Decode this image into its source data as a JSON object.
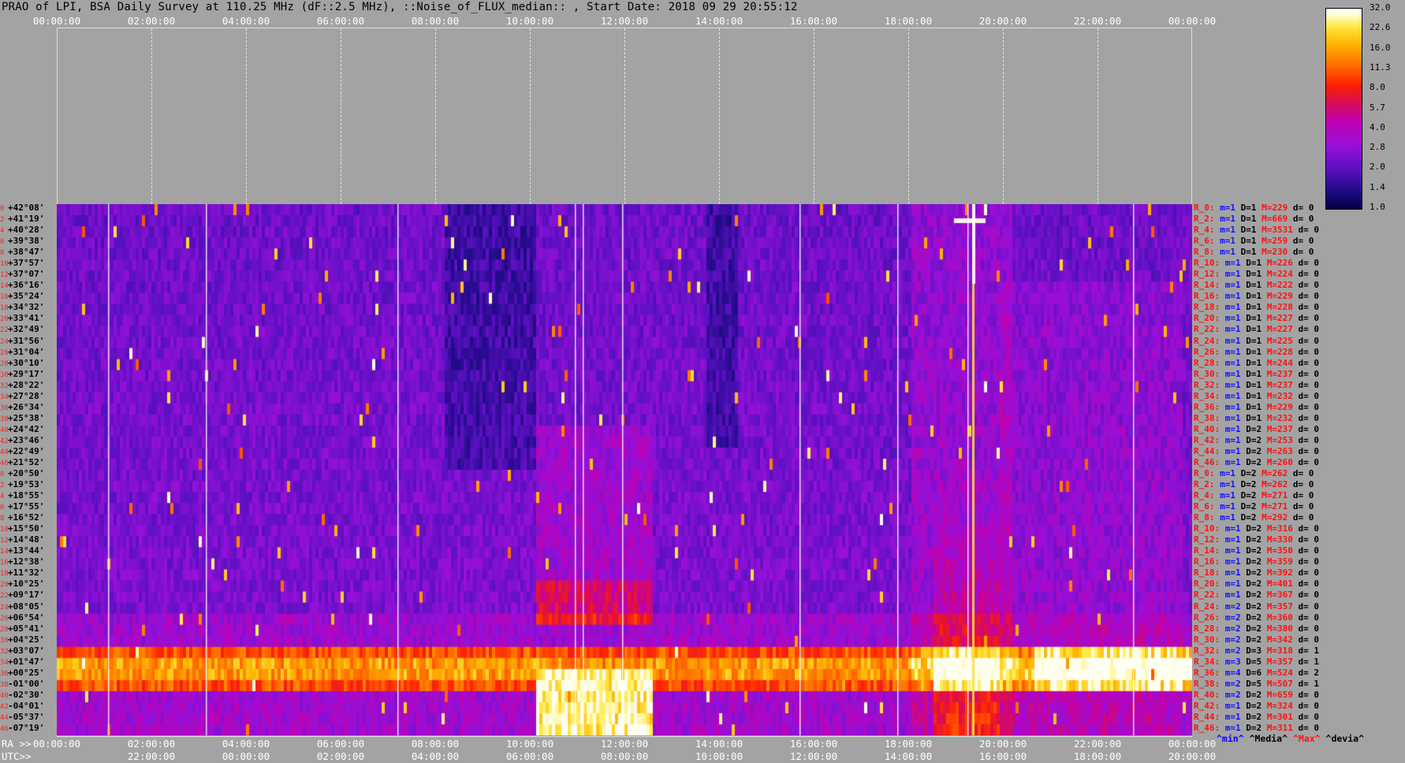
{
  "title": "PRAO of LPI, BSA Daily Survey at 110.25 MHz (dF::2.5 MHz), ::Noise_of_FLUX_median:: , Start Date: 2018 09 29 20:55:12",
  "top_axis_labels": [
    "00:00:00",
    "02:00:00",
    "04:00:00",
    "06:00:00",
    "08:00:00",
    "10:00:00",
    "12:00:00",
    "14:00:00",
    "16:00:00",
    "18:00:00",
    "20:00:00",
    "22:00:00",
    "00:00:00"
  ],
  "ra_axis_labels": [
    "00:00:00",
    "02:00:00",
    "04:00:00",
    "06:00:00",
    "08:00:00",
    "10:00:00",
    "12:00:00",
    "14:00:00",
    "16:00:00",
    "18:00:00",
    "20:00:00",
    "22:00:00",
    "00:00:00"
  ],
  "utc_axis_labels": [
    "22:00:00",
    "00:00:00",
    "02:00:00",
    "04:00:00",
    "06:00:00",
    "08:00:00",
    "10:00:00",
    "12:00:00",
    "14:00:00",
    "16:00:00",
    "18:00:00",
    "20:00:00"
  ],
  "ra_prefix": "RA >>",
  "utc_prefix": "UTC>>",
  "colorbar": {
    "ticks": [
      "32.0",
      "22.6",
      "16.0",
      "11.3",
      "8.0",
      "5.7",
      "4.0",
      "2.8",
      "2.0",
      "1.4",
      "1.0"
    ],
    "colors": [
      "#000040",
      "#5a10c0",
      "#c000b0",
      "#ff2000",
      "#ffb000",
      "#ffffff"
    ]
  },
  "declinations": [
    {
      "idx": "0",
      "dec": "+42°08'"
    },
    {
      "idx": "2",
      "dec": "+41°19'"
    },
    {
      "idx": "4",
      "dec": "+40°28'"
    },
    {
      "idx": "6",
      "dec": "+39°38'"
    },
    {
      "idx": "8",
      "dec": "+38°47'"
    },
    {
      "idx": "10",
      "dec": "+37°57'"
    },
    {
      "idx": "12",
      "dec": "+37°07'"
    },
    {
      "idx": "14",
      "dec": "+36°16'"
    },
    {
      "idx": "16",
      "dec": "+35°24'"
    },
    {
      "idx": "18",
      "dec": "+34°32'"
    },
    {
      "idx": "20",
      "dec": "+33°41'"
    },
    {
      "idx": "22",
      "dec": "+32°49'"
    },
    {
      "idx": "24",
      "dec": "+31°56'"
    },
    {
      "idx": "26",
      "dec": "+31°04'"
    },
    {
      "idx": "28",
      "dec": "+30°10'"
    },
    {
      "idx": "30",
      "dec": "+29°17'"
    },
    {
      "idx": "32",
      "dec": "+28°22'"
    },
    {
      "idx": "34",
      "dec": "+27°28'"
    },
    {
      "idx": "36",
      "dec": "+26°34'"
    },
    {
      "idx": "38",
      "dec": "+25°38'"
    },
    {
      "idx": "40",
      "dec": "+24°42'"
    },
    {
      "idx": "42",
      "dec": "+23°46'"
    },
    {
      "idx": "44",
      "dec": "+22°49'"
    },
    {
      "idx": "46",
      "dec": "+21°52'"
    },
    {
      "idx": "0",
      "dec": "+20°50'"
    },
    {
      "idx": "2",
      "dec": "+19°53'"
    },
    {
      "idx": "4",
      "dec": "+18°55'"
    },
    {
      "idx": "6",
      "dec": "+17°55'"
    },
    {
      "idx": "8",
      "dec": "+16°52'"
    },
    {
      "idx": "10",
      "dec": "+15°50'"
    },
    {
      "idx": "12",
      "dec": "+14°48'"
    },
    {
      "idx": "14",
      "dec": "+13°44'"
    },
    {
      "idx": "16",
      "dec": "+12°38'"
    },
    {
      "idx": "18",
      "dec": "+11°32'"
    },
    {
      "idx": "20",
      "dec": "+10°25'"
    },
    {
      "idx": "22",
      "dec": "+09°17'"
    },
    {
      "idx": "24",
      "dec": "+08°05'"
    },
    {
      "idx": "26",
      "dec": "+06°54'"
    },
    {
      "idx": "28",
      "dec": "+05°41'"
    },
    {
      "idx": "30",
      "dec": "+04°25'"
    },
    {
      "idx": "32",
      "dec": "+03°07'"
    },
    {
      "idx": "34",
      "dec": "+01°47'"
    },
    {
      "idx": "36",
      "dec": "+00°25'"
    },
    {
      "idx": "38",
      "dec": "-01°00'"
    },
    {
      "idx": "40",
      "dec": "-02°30'"
    },
    {
      "idx": "42",
      "dec": "-04°01'"
    },
    {
      "idx": "44",
      "dec": "-05°37'"
    },
    {
      "idx": "46",
      "dec": "-07°19'"
    }
  ],
  "row_stats": [
    {
      "r": "R_0:",
      "m": "m=1",
      "d": "D=1",
      "M": "M=229",
      "dd": "d= 0"
    },
    {
      "r": "R_2:",
      "m": "m=1",
      "d": "D=1",
      "M": "M=669",
      "dd": "d= 0"
    },
    {
      "r": "R_4:",
      "m": "m=1",
      "d": "D=1",
      "M": "M=3531",
      "dd": "d= 0"
    },
    {
      "r": "R_6:",
      "m": "m=1",
      "d": "D=1",
      "M": "M=259",
      "dd": "d= 0"
    },
    {
      "r": "R_8:",
      "m": "m=1",
      "d": "D=1",
      "M": "M=230",
      "dd": "d= 0"
    },
    {
      "r": "R_10:",
      "m": "m=1",
      "d": "D=1",
      "M": "M=226",
      "dd": "d= 0"
    },
    {
      "r": "R_12:",
      "m": "m=1",
      "d": "D=1",
      "M": "M=224",
      "dd": "d= 0"
    },
    {
      "r": "R_14:",
      "m": "m=1",
      "d": "D=1",
      "M": "M=222",
      "dd": "d= 0"
    },
    {
      "r": "R_16:",
      "m": "m=1",
      "d": "D=1",
      "M": "M=229",
      "dd": "d= 0"
    },
    {
      "r": "R_18:",
      "m": "m=1",
      "d": "D=1",
      "M": "M=228",
      "dd": "d= 0"
    },
    {
      "r": "R_20:",
      "m": "m=1",
      "d": "D=1",
      "M": "M=227",
      "dd": "d= 0"
    },
    {
      "r": "R_22:",
      "m": "m=1",
      "d": "D=1",
      "M": "M=227",
      "dd": "d= 0"
    },
    {
      "r": "R_24:",
      "m": "m=1",
      "d": "D=1",
      "M": "M=225",
      "dd": "d= 0"
    },
    {
      "r": "R_26:",
      "m": "m=1",
      "d": "D=1",
      "M": "M=228",
      "dd": "d= 0"
    },
    {
      "r": "R_28:",
      "m": "m=1",
      "d": "D=1",
      "M": "M=244",
      "dd": "d= 0"
    },
    {
      "r": "R_30:",
      "m": "m=1",
      "d": "D=1",
      "M": "M=237",
      "dd": "d= 0"
    },
    {
      "r": "R_32:",
      "m": "m=1",
      "d": "D=1",
      "M": "M=237",
      "dd": "d= 0"
    },
    {
      "r": "R_34:",
      "m": "m=1",
      "d": "D=1",
      "M": "M=232",
      "dd": "d= 0"
    },
    {
      "r": "R_36:",
      "m": "m=1",
      "d": "D=1",
      "M": "M=229",
      "dd": "d= 0"
    },
    {
      "r": "R_38:",
      "m": "m=1",
      "d": "D=1",
      "M": "M=232",
      "dd": "d= 0"
    },
    {
      "r": "R_40:",
      "m": "m=1",
      "d": "D=2",
      "M": "M=237",
      "dd": "d= 0"
    },
    {
      "r": "R_42:",
      "m": "m=1",
      "d": "D=2",
      "M": "M=253",
      "dd": "d= 0"
    },
    {
      "r": "R_44:",
      "m": "m=1",
      "d": "D=2",
      "M": "M=263",
      "dd": "d= 0"
    },
    {
      "r": "R_46:",
      "m": "m=1",
      "d": "D=2",
      "M": "M=260",
      "dd": "d= 0"
    },
    {
      "r": "R_0:",
      "m": "m=1",
      "d": "D=2",
      "M": "M=262",
      "dd": "d= 0"
    },
    {
      "r": "R_2:",
      "m": "m=1",
      "d": "D=2",
      "M": "M=262",
      "dd": "d= 0"
    },
    {
      "r": "R_4:",
      "m": "m=1",
      "d": "D=2",
      "M": "M=271",
      "dd": "d= 0"
    },
    {
      "r": "R_6:",
      "m": "m=1",
      "d": "D=2",
      "M": "M=271",
      "dd": "d= 0"
    },
    {
      "r": "R_8:",
      "m": "m=1",
      "d": "D=2",
      "M": "M=292",
      "dd": "d= 0"
    },
    {
      "r": "R_10:",
      "m": "m=1",
      "d": "D=2",
      "M": "M=316",
      "dd": "d= 0"
    },
    {
      "r": "R_12:",
      "m": "m=1",
      "d": "D=2",
      "M": "M=330",
      "dd": "d= 0"
    },
    {
      "r": "R_14:",
      "m": "m=1",
      "d": "D=2",
      "M": "M=350",
      "dd": "d= 0"
    },
    {
      "r": "R_16:",
      "m": "m=1",
      "d": "D=2",
      "M": "M=359",
      "dd": "d= 0"
    },
    {
      "r": "R_18:",
      "m": "m=1",
      "d": "D=2",
      "M": "M=392",
      "dd": "d= 0"
    },
    {
      "r": "R_20:",
      "m": "m=1",
      "d": "D=2",
      "M": "M=401",
      "dd": "d= 0"
    },
    {
      "r": "R_22:",
      "m": "m=1",
      "d": "D=2",
      "M": "M=367",
      "dd": "d= 0"
    },
    {
      "r": "R_24:",
      "m": "m=2",
      "d": "D=2",
      "M": "M=357",
      "dd": "d= 0"
    },
    {
      "r": "R_26:",
      "m": "m=2",
      "d": "D=2",
      "M": "M=360",
      "dd": "d= 0"
    },
    {
      "r": "R_28:",
      "m": "m=2",
      "d": "D=2",
      "M": "M=380",
      "dd": "d= 0"
    },
    {
      "r": "R_30:",
      "m": "m=2",
      "d": "D=2",
      "M": "M=342",
      "dd": "d= 0"
    },
    {
      "r": "R_32:",
      "m": "m=2",
      "d": "D=3",
      "M": "M=318",
      "dd": "d= 1"
    },
    {
      "r": "R_34:",
      "m": "m=3",
      "d": "D=5",
      "M": "M=357",
      "dd": "d= 1"
    },
    {
      "r": "R_36:",
      "m": "m=4",
      "d": "D=6",
      "M": "M=524",
      "dd": "d= 2"
    },
    {
      "r": "R_38:",
      "m": "m=2",
      "d": "D=5",
      "M": "M=507",
      "dd": "d= 1"
    },
    {
      "r": "R_40:",
      "m": "m=2",
      "d": "D=2",
      "M": "M=659",
      "dd": "d= 0"
    },
    {
      "r": "R_42:",
      "m": "m=1",
      "d": "D=2",
      "M": "M=324",
      "dd": "d= 0"
    },
    {
      "r": "R_44:",
      "m": "m=1",
      "d": "D=2",
      "M": "M=301",
      "dd": "d= 0"
    },
    {
      "r": "R_46:",
      "m": "m=1",
      "d": "D=2",
      "M": "M=311",
      "dd": "d= 0"
    }
  ],
  "legend": {
    "min": "^min^",
    "median": "^Media^",
    "max": "^Max^",
    "dev": "^devia^"
  }
}
